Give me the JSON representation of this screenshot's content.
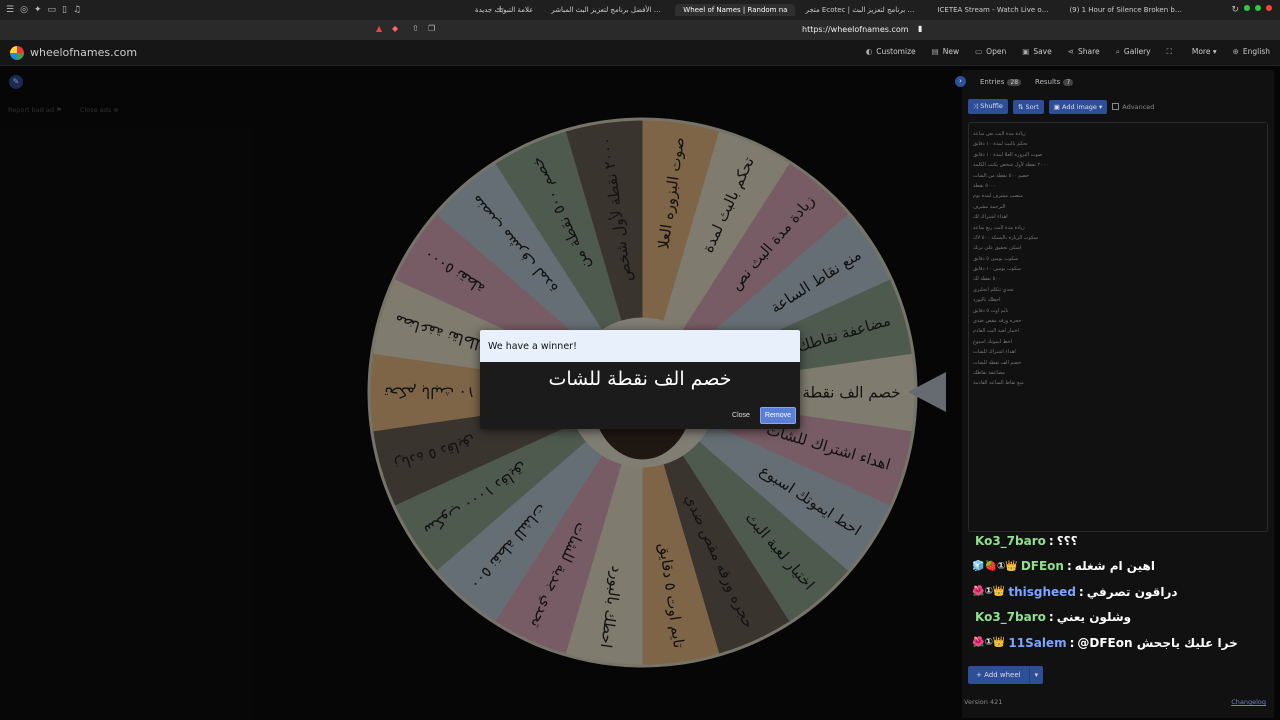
{
  "browser": {
    "tabs": [
      {
        "label": "علامة التبويب جديدة",
        "active": false
      },
      {
        "label": "البوت الأفضل برنامج لتعزيز البث المباشر",
        "active": false
      },
      {
        "label": "Wheel of Names | Random na",
        "active": true
      },
      {
        "label": "متجر Ecotec | أفضل برنامج لتعزيز البث",
        "active": false
      },
      {
        "label": "ICETEA Stream - Watch Live on K",
        "active": false
      },
      {
        "label": "(9) 1 Hour of Silence Broken by Sh",
        "active": false
      }
    ],
    "url": "https://wheelofnames.com"
  },
  "site": {
    "logo_text": "wheelofnames.com",
    "nav": [
      {
        "label": "Customize",
        "icon": "palette-icon"
      },
      {
        "label": "New",
        "icon": "file-icon"
      },
      {
        "label": "Open",
        "icon": "folder-icon"
      },
      {
        "label": "Save",
        "icon": "save-icon"
      },
      {
        "label": "Share",
        "icon": "share-icon"
      },
      {
        "label": "Gallery",
        "icon": "search-icon"
      },
      {
        "label": "",
        "icon": "fullscreen-icon"
      },
      {
        "label": "More ▾",
        "icon": ""
      },
      {
        "label": "English",
        "icon": "globe-icon"
      }
    ]
  },
  "left": {
    "report_label": "Report bad ad",
    "close_ads_label": "Close ads"
  },
  "wheel": {
    "colors": [
      "#e8e0c8",
      "#d9a7b8",
      "#b9c9d4",
      "#8fa58f",
      "#6b5f55",
      "#e5b982"
    ],
    "segments": [
      "خصم الف نقطة للشات",
      "اهداء اشتراك للشات",
      "احط ايموتك اسبوع",
      "اختيار لعبة البث",
      "حجره ورقه مقص ضدي",
      "تايم اوت ٥ دقايق",
      "احطك بالبورد",
      "تحدي جدية للشات",
      "٥٠٠ نقطة للشات",
      "سكوب ١٠٠٠ دقايق",
      "زيادة ٥ دقايق",
      "تحكم بالبث ١٠",
      "مضاعفة نقاطك",
      "٥٠٠٠ نقطة",
      "منصب مشرف لمدة",
      "خصم ٥٠٠ نقطة من",
      "٢٠٠٠ نقطة لأول شخص",
      "صوت البزوره العلا",
      "تحكم بالبث لمدة",
      "زيادة مدة البث نص",
      "منع نقاط الساعة",
      "مضاعفة نقاطك"
    ]
  },
  "modal": {
    "title": "We have a winner!",
    "winner": "خصم الف نقطة للشات",
    "close_label": "Close",
    "remove_label": "Remove"
  },
  "panel": {
    "tabs": [
      {
        "label": "Entries",
        "count": "28"
      },
      {
        "label": "Results",
        "count": "7"
      }
    ],
    "buttons": {
      "shuffle": "Shuffle",
      "sort": "Sort",
      "add_image": "Add image",
      "advanced": "Advanced"
    },
    "entries": [
      "زيادة مدة البث نص ساعة",
      "تحكم بالبث لمدة ١٠ دقايق",
      "صوت البزوره العلا لمدة ١٠ دقايق",
      "٢٠٠٠ نقطة لأول شخص يكتب الكلمة",
      "خصم ٥٠٠ نقطة من الشات",
      "٥٠٠٠ نقطة",
      "منصب مشرف لمدة يوم",
      "الترجمة مشرف",
      "اهداء اشتراك لك",
      "زيادة مدة البث ربع ساعة",
      "سكوب الزيارة بالبسكد ٥٠٠ لاك",
      "اسكن تحقيق على ترنك",
      "سكوب يومين ٥ دقايق",
      "سكوب يومين ١٠ دقايق",
      "٥٠٠ نقطة لك",
      "تحدي تتكلم انجليزي",
      "احطك بالبورد",
      "تايم اوت ٥ دقايق",
      "حجره ورقه مقص ضدي",
      "اختيار لعبة البث القادم",
      "احط ايموتك اسبوع",
      "اهداء اشتراك للشات",
      "خصم الف نقطة للشات",
      "مضاعفة نقاطك",
      "منع نقاط الساعة القادمة"
    ],
    "chat": [
      {
        "user": "Ko3_7baro",
        "color": "#8fe08f",
        "badges": "",
        "msg": "؟؟؟"
      },
      {
        "user": "DFEon",
        "color": "#8fe08f",
        "badges": "🧊🍓①👑",
        "msg": "اهين ام شغله"
      },
      {
        "user": "thisgheed",
        "color": "#7aa6ff",
        "badges": "🌺①👑",
        "msg": "دراقون تصرفي"
      },
      {
        "user": "Ko3_7baro",
        "color": "#8fe08f",
        "badges": "",
        "msg": "وشلون يعني"
      },
      {
        "user": "11Salem",
        "color": "#7aa6ff",
        "badges": "🌺①👑",
        "msg": "@DFEon خرا عليك ياجحش"
      }
    ],
    "add_wheel_label": "Add wheel",
    "version": "Version 421",
    "changelog": "Changelog"
  }
}
